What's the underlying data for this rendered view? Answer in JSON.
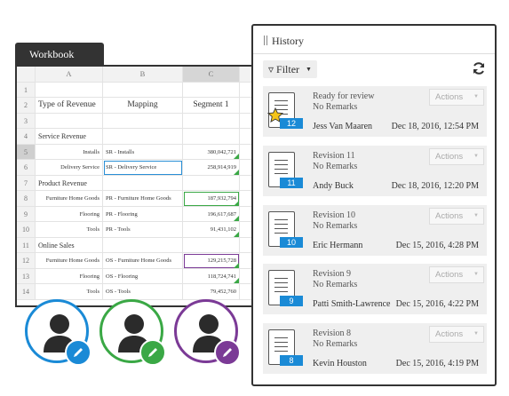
{
  "workbook": {
    "tab_label": "Workbook",
    "columns": [
      "A",
      "B",
      "C"
    ],
    "rows": [
      {
        "n": "1",
        "a": "",
        "b": "",
        "c": ""
      },
      {
        "n": "2",
        "a": "Type of Revenue",
        "b": "Mapping",
        "c": "Segment 1"
      },
      {
        "n": "3",
        "a": "",
        "b": "",
        "c": ""
      },
      {
        "n": "4",
        "a": "Service Revenue",
        "b": "",
        "c": ""
      },
      {
        "n": "5",
        "a": "Installs",
        "b": "SR - Installs",
        "c": "380,042,721"
      },
      {
        "n": "6",
        "a": "Delivery Service",
        "b": "SR - Delivery Service",
        "c": "258,914,919"
      },
      {
        "n": "7",
        "a": "Product Revenue",
        "b": "",
        "c": ""
      },
      {
        "n": "8",
        "a": "Furniture Home Goods",
        "b": "PR - Furniture Home Goods",
        "c": "187,932,794"
      },
      {
        "n": "9",
        "a": "Flooring",
        "b": "PR - Flooring",
        "c": "196,617,687"
      },
      {
        "n": "10",
        "a": "Tools",
        "b": "PR - Tools",
        "c": "91,431,102"
      },
      {
        "n": "11",
        "a": "Online Sales",
        "b": "",
        "c": ""
      },
      {
        "n": "12",
        "a": "Furniture Home Goods",
        "b": "OS - Furniture Home Goods",
        "c": "129,215,728"
      },
      {
        "n": "13",
        "a": "Flooring",
        "b": "OS - Flooring",
        "c": "118,724,741"
      },
      {
        "n": "14",
        "a": "Tools",
        "b": "OS - Tools",
        "c": "79,452,760"
      }
    ]
  },
  "avatars": [
    {
      "color": "#1a8ad6",
      "icon": "pencil-icon"
    },
    {
      "color": "#3aa845",
      "icon": "pencil-icon"
    },
    {
      "color": "#7b3a96",
      "icon": "pencil-icon"
    }
  ],
  "history": {
    "title": "History",
    "filter_label": "Filter",
    "actions_label": "Actions",
    "revisions": [
      {
        "number": "12",
        "title": "Ready for review",
        "remarks": "No Remarks",
        "user": "Jess Van Maaren",
        "date": "Dec 18, 2016, 12:54 PM",
        "starred": true
      },
      {
        "number": "11",
        "title": "Revision 11",
        "remarks": "No Remarks",
        "user": "Andy Buck",
        "date": "Dec 18, 2016, 12:20 PM",
        "starred": false
      },
      {
        "number": "10",
        "title": "Revision 10",
        "remarks": "No Remarks",
        "user": "Eric Hermann",
        "date": "Dec 15, 2016, 4:28 PM",
        "starred": false
      },
      {
        "number": "9",
        "title": "Revision 9",
        "remarks": "No Remarks",
        "user": "Patti Smith-Lawrence",
        "date": "Dec 15, 2016, 4:22 PM",
        "starred": false
      },
      {
        "number": "8",
        "title": "Revision 8",
        "remarks": "No Remarks",
        "user": "Kevin Houston",
        "date": "Dec 15, 2016, 4:19 PM",
        "starred": false
      }
    ]
  }
}
